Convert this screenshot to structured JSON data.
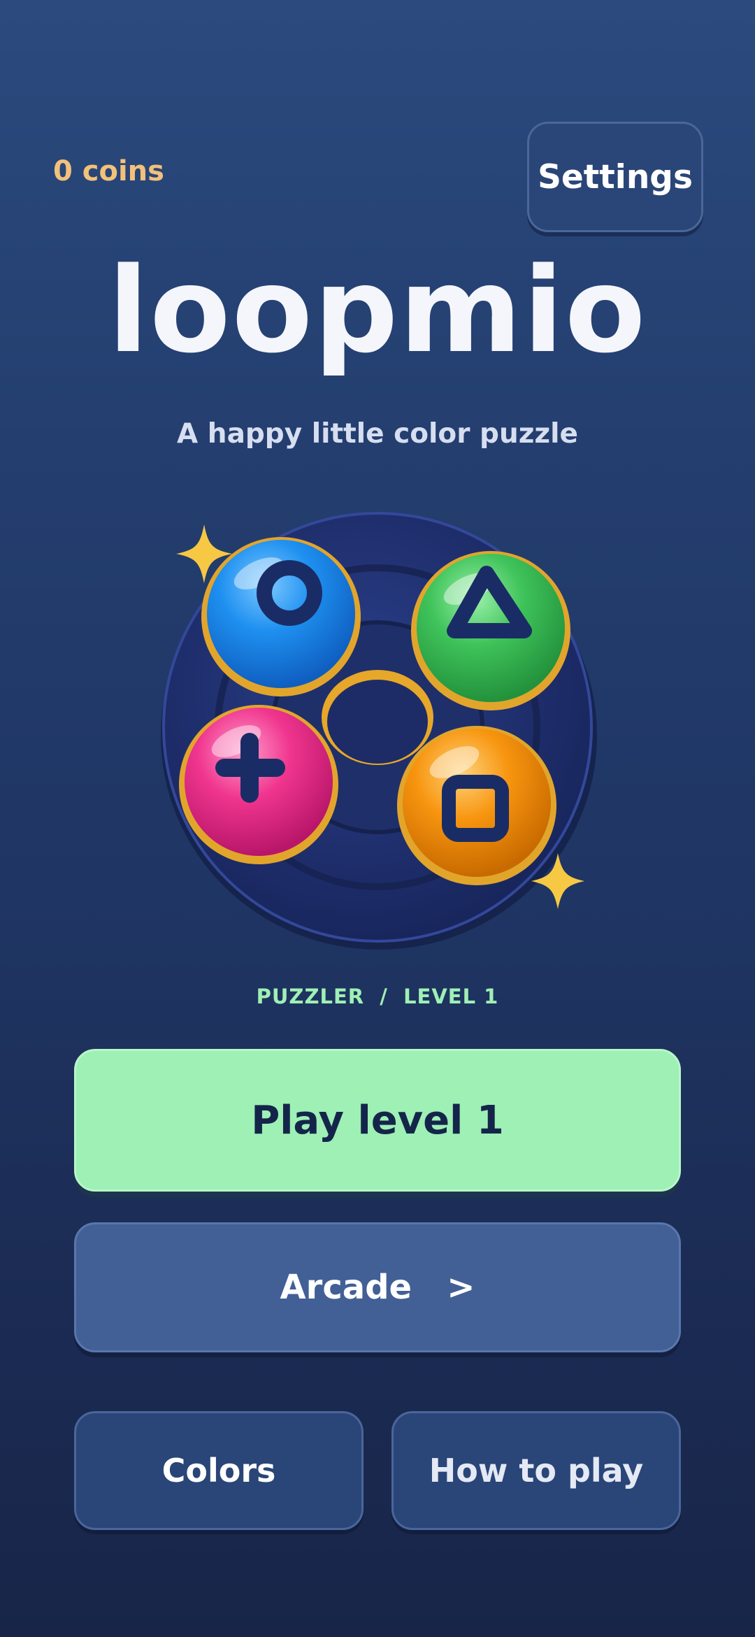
{
  "header": {
    "coins_text": "0 coins",
    "settings_label": "Settings"
  },
  "hero": {
    "title": "loopmio",
    "subtitle": "A happy little color puzzle"
  },
  "puzzle_art": {
    "pieces": [
      {
        "color": "#1e90f0",
        "symbol": "circle-icon"
      },
      {
        "color": "#3fc35a",
        "symbol": "triangle-icon"
      },
      {
        "color": "#f0358e",
        "symbol": "plus-icon"
      },
      {
        "color": "#f7950f",
        "symbol": "square-icon"
      }
    ],
    "ring_color": "#1e2f6b",
    "sparkle_color": "#f7c843"
  },
  "progress": {
    "label": "PUZZLER  /  LEVEL 1"
  },
  "menu": {
    "play_label": "Play level 1",
    "arcade_label": "Arcade   >",
    "colors_label": "Colors",
    "how_to_play_label": "How to play"
  },
  "colors": {
    "accent_green": "#9ef0b5",
    "coins_gold": "#f2c17a",
    "panel_blue": "#2a4577",
    "arcade_blue": "#425f96"
  }
}
